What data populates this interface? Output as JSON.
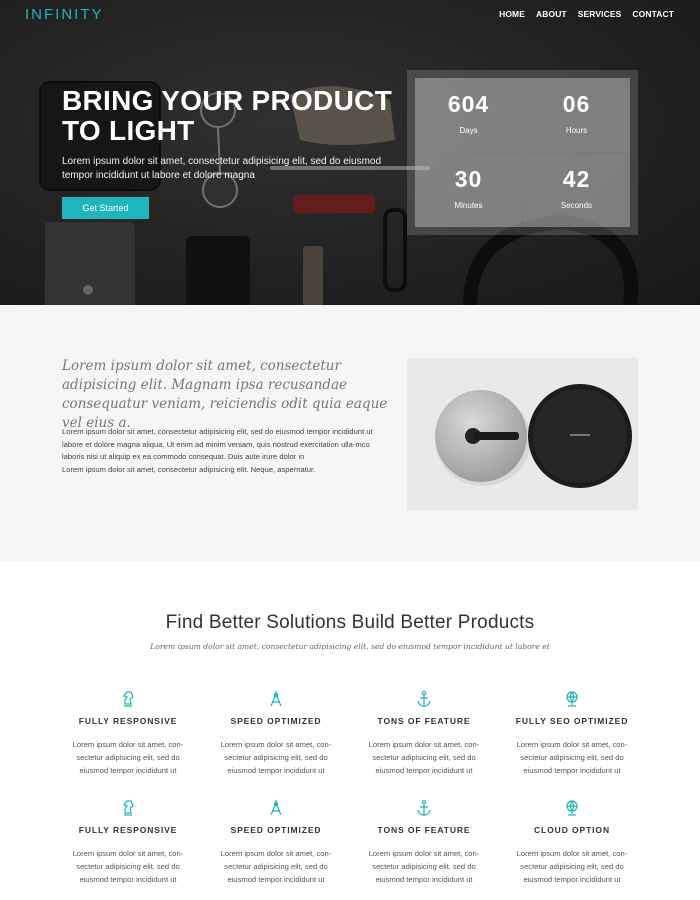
{
  "nav": {
    "logo": "INFINITY",
    "items": [
      "HOME",
      "ABOUT",
      "SERVICES",
      "CONTACT"
    ]
  },
  "hero": {
    "title": "BRING YOUR PRODUCT TO LIGHT",
    "text": "Lorem ipsum dolor sit amet, consectetur adipisicing elit, sed do eiusmod tempor incididunt ut labore et dolore magna",
    "cta": "Get Started"
  },
  "countdown": [
    {
      "value": "604",
      "label": "Days"
    },
    {
      "value": "06",
      "label": "Hours"
    },
    {
      "value": "30",
      "label": "Minutes"
    },
    {
      "value": "42",
      "label": "Seconds"
    }
  ],
  "about": {
    "lead": "Lorem ipsum dolor sit amet, consectetur adipisicing elit. Magnam ipsa recusandae consequatur veniam, reiciendis odit quia eaque vel eius a.",
    "body": "Lorem ipsum dolor sit amet, consectetur adipisicing elit, sed do eiusmod tempor incididunt ut labore et dolore magna aliqua. Ut enim ad minim veniam, quis nostrud exercitation ulla-mco laboris nisi ut aliquip ex ea commodo consequat. Duis aute irure dolor in",
    "body2": "Lorem ipsum dolor sit amet, consectetur adipisicing elit. Neque, aspernatur."
  },
  "features": {
    "title": "Find Better Solutions Build Better Products",
    "subtitle": "Lorem ipsum dolor sit amet, consectetur adipisicing elit, sed do eiusmod tempor incididunt ut labore et",
    "items": [
      {
        "icon": "knight-icon",
        "title": "FULLY RESPONSIVE",
        "desc": "Lorem ipsum dolor sit amet, con-sectetur adipisicing elit, sed do eiusmod tempor incididunt ut"
      },
      {
        "icon": "compass-icon",
        "title": "SPEED OPTIMIZED",
        "desc": "Lorem ipsum dolor sit amet, con-sectetur adipisicing elit, sed do eiusmod tempor incididunt ut"
      },
      {
        "icon": "anchor-icon",
        "title": "TONS OF FEATURE",
        "desc": "Lorem ipsum dolor sit amet, con-sectetur adipisicing elit, sed do eiusmod tempor incididunt ut"
      },
      {
        "icon": "globe-icon",
        "title": "FULLY SEO OPTIMIZED",
        "desc": "Lorem ipsum dolor sit amet, con-sectetur adipisicing elit, sed do eiusmod tempor incididunt ut"
      },
      {
        "icon": "knight-icon",
        "title": "FULLY RESPONSIVE",
        "desc": "Lorem ipsum dolor sit amet, con-sectetur adipisicing elit, sed do eiusmod tempor incididunt ut"
      },
      {
        "icon": "compass-icon",
        "title": "SPEED OPTIMIZED",
        "desc": "Lorem ipsum dolor sit amet, con-sectetur adipisicing elit, sed do eiusmod tempor incididunt ut"
      },
      {
        "icon": "anchor-icon",
        "title": "TONS OF FEATURE",
        "desc": "Lorem ipsum dolor sit amet, con-sectetur adipisicing elit, sed do eiusmod tempor incididunt ut"
      },
      {
        "icon": "globe-icon",
        "title": "CLOUD OPTION",
        "desc": "Lorem ipsum dolor sit amet, con-sectetur adipisicing elit, sed do eiusmod tempor incididunt ut"
      }
    ]
  },
  "colors": {
    "accent": "#1fb5bc",
    "hero_bg": "#2a2a2a",
    "about_bg": "#f6f6f6"
  }
}
